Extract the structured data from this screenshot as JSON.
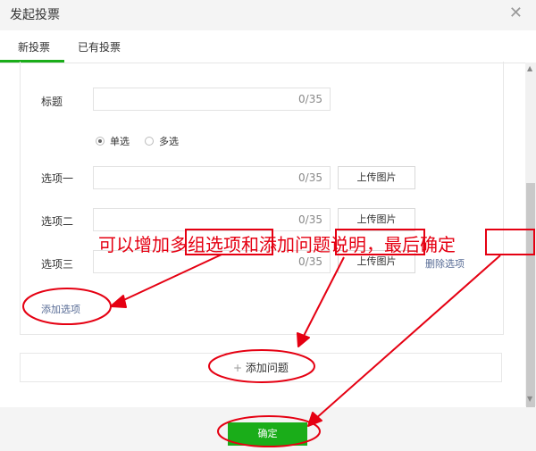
{
  "dialog": {
    "title": "发起投票"
  },
  "tabs": [
    {
      "label": "新投票"
    },
    {
      "label": "已有投票"
    }
  ],
  "form": {
    "title_label": "标题",
    "title_count": "0/35",
    "radio_single": "单选",
    "radio_multi": "多选",
    "options": [
      {
        "label": "选项一",
        "count": "0/35",
        "upload": "上传图片"
      },
      {
        "label": "选项二",
        "count": "0/35",
        "upload": "上传图片"
      },
      {
        "label": "选项三",
        "count": "0/35",
        "upload": "上传图片",
        "delete": "删除选项"
      }
    ],
    "add_option": "添加选项",
    "add_question": "添加问题",
    "confirm": "确定"
  },
  "annotation": {
    "text": "可以增加多组选项和添加问题说明，最后确定",
    "color": "#e50012"
  },
  "colors": {
    "accent": "#1aad19",
    "link": "#576b95"
  }
}
